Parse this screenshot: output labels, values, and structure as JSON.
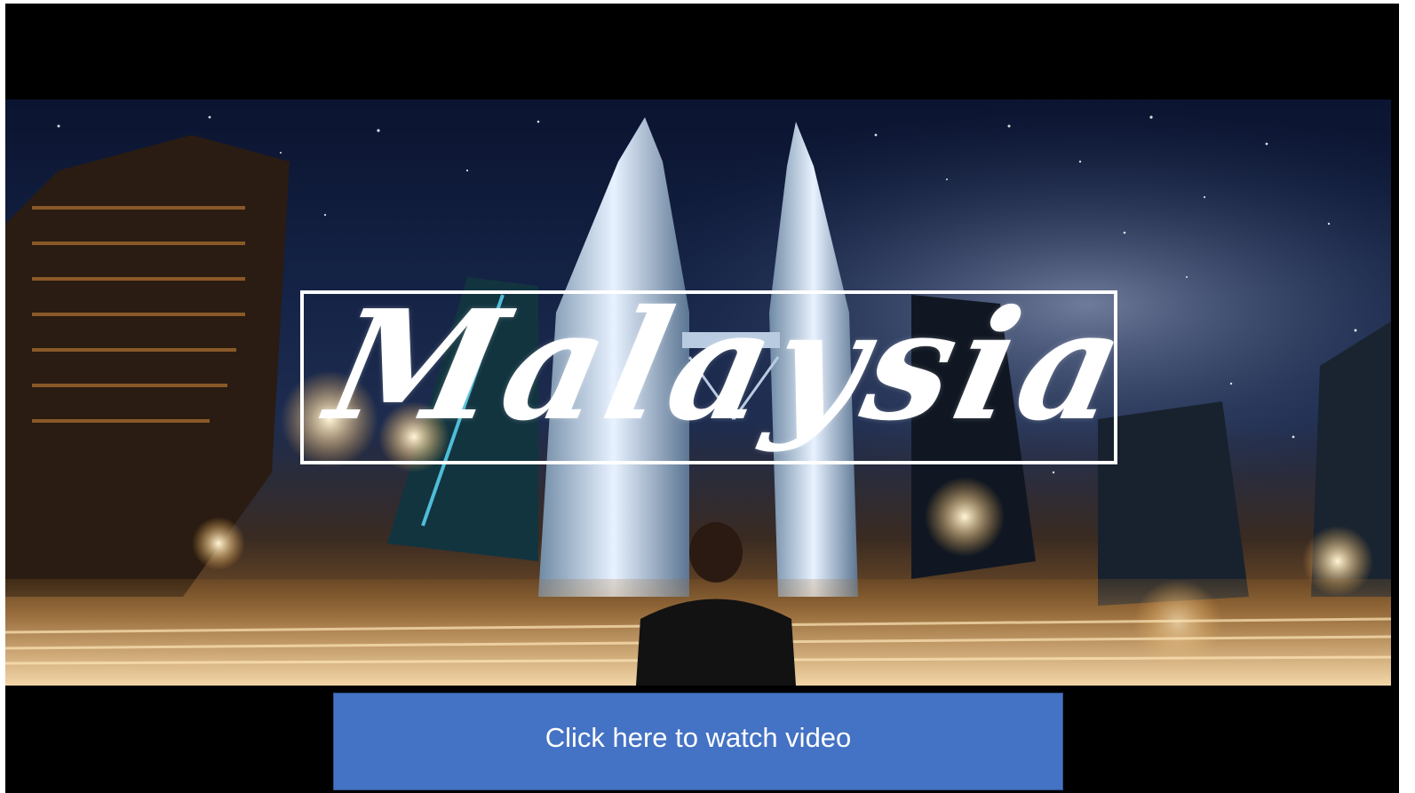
{
  "slide": {
    "background_color": "#000000",
    "hero": {
      "title": "Malaysia",
      "title_color": "#ffffff"
    },
    "button": {
      "label": "Click here to watch video",
      "background_color": "#4472c4",
      "text_color": "#ffffff"
    }
  }
}
